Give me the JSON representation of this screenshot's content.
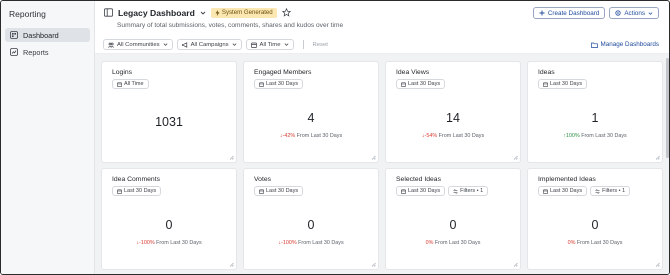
{
  "sidebar": {
    "title": "Reporting",
    "items": [
      {
        "label": "Dashboard",
        "active": true
      },
      {
        "label": "Reports",
        "active": false
      }
    ]
  },
  "header": {
    "title": "Legacy Dashboard",
    "badge": "System Generated",
    "subtitle": "Summary of total submissions, votes, comments, shares and kudos over time",
    "create_label": "Create Dashboard",
    "actions_label": "Actions"
  },
  "filters": {
    "communities": "All Communities",
    "campaigns": "All Campaigns",
    "time": "All Time",
    "reset": "Reset",
    "manage": "Manage Dashboards"
  },
  "cards": [
    {
      "title": "Logins",
      "period": "All Time",
      "value": "1031",
      "change_pct": "",
      "change_text": ""
    },
    {
      "title": "Engaged Members",
      "period": "Last 30 Days",
      "value": "4",
      "change_pct": "-42%",
      "change_text": "From Last 30 Days",
      "trend": "down"
    },
    {
      "title": "Idea Views",
      "period": "Last 30 Days",
      "value": "14",
      "change_pct": "-54%",
      "change_text": "From Last 30 Days",
      "trend": "down"
    },
    {
      "title": "Ideas",
      "period": "Last 30 Days",
      "value": "1",
      "change_pct": "100%",
      "change_text": "From Last 30 Days",
      "trend": "up"
    },
    {
      "title": "Idea Comments",
      "period": "Last 30 Days",
      "value": "0",
      "change_pct": "-100%",
      "change_text": "From Last 30 Days",
      "trend": "down"
    },
    {
      "title": "Votes",
      "period": "Last 30 Days",
      "value": "0",
      "change_pct": "-100%",
      "change_text": "From Last 30 Days",
      "trend": "down"
    },
    {
      "title": "Selected Ideas",
      "period": "Last 30 Days",
      "filters": "Filters • 1",
      "value": "0",
      "change_pct": "0%",
      "change_text": "From Last 30 Days",
      "trend": "flat"
    },
    {
      "title": "Implemented Ideas",
      "period": "Last 30 Days",
      "filters": "Filters • 1",
      "value": "0",
      "change_pct": "0%",
      "change_text": "From Last 30 Days",
      "trend": "flat"
    }
  ],
  "colors": {
    "accent": "#1e4a9c",
    "badge_bg": "#fbe7b1",
    "down": "#d63b2f",
    "up": "#2f8f46"
  }
}
